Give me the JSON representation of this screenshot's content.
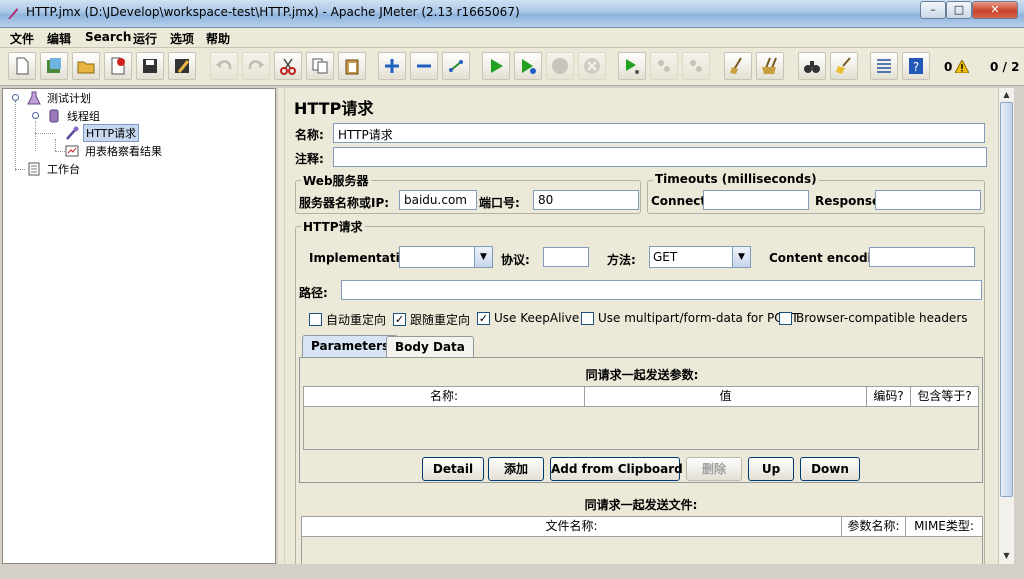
{
  "window": {
    "title": "HTTP.jmx (D:\\JDevelop\\workspace-test\\HTTP.jmx) - Apache JMeter (2.13 r1665067)",
    "controls": {
      "minimize": "–",
      "maximize": "□",
      "close": "✕"
    }
  },
  "menu": [
    "文件",
    "编辑",
    "Search",
    "运行",
    "选项",
    "帮助"
  ],
  "toolbar": {
    "buttons": [
      "new-icon",
      "templates-icon",
      "open-icon",
      "close-file-icon",
      "save-icon",
      "save-as-icon",
      "undo-icon",
      "redo-icon",
      "cut-icon",
      "copy-icon",
      "paste-icon",
      "expand-icon",
      "collapse-icon",
      "toggle-icon",
      "start-icon",
      "start-no-pause-icon",
      "stop-icon",
      "shutdown-icon",
      "remote-start-icon",
      "remote-stop-icon",
      "remote-shutdown-icon",
      "clear-icon",
      "clear-all-icon",
      "search-icon",
      "reset-search-icon",
      "function-helper-icon",
      "help-icon"
    ],
    "error_count": "0",
    "thread_count": "0 / 2"
  },
  "tree": {
    "test_plan": "测试计划",
    "thread_group": "线程组",
    "http_request": "HTTP请求",
    "result_table": "用表格察看结果",
    "workbench": "工作台"
  },
  "panel": {
    "heading": "HTTP请求",
    "name_label": "名称:",
    "name_value": "HTTP请求",
    "comment_label": "注释:",
    "comment_value": "",
    "web_server": {
      "title": "Web服务器",
      "server_label": "服务器名称或IP:",
      "server_value": "baidu.com",
      "port_label": "端口号:",
      "port_value": "80"
    },
    "timeouts": {
      "title": "Timeouts (milliseconds)",
      "connect_label": "Connect:",
      "connect_value": "",
      "response_label": "Response:",
      "response_value": ""
    },
    "http_request": {
      "title": "HTTP请求",
      "implementation_label": "Implementation:",
      "implementation_value": "",
      "protocol_label": "协议:",
      "protocol_value": "",
      "method_label": "方法:",
      "method_value": "GET",
      "encoding_label": "Content encoding:",
      "encoding_value": "",
      "path_label": "路径:",
      "path_value": ""
    },
    "options": [
      {
        "label": "自动重定向",
        "checked": false
      },
      {
        "label": "跟随重定向",
        "checked": true
      },
      {
        "label": "Use KeepAlive",
        "checked": true
      },
      {
        "label": "Use multipart/form-data for POST",
        "checked": false
      },
      {
        "label": "Browser-compatible headers",
        "checked": false
      }
    ],
    "tabs": [
      "Parameters",
      "Body Data"
    ],
    "params_caption": "同请求一起发送参数:",
    "params_columns": [
      "名称:",
      "值",
      "编码?",
      "包含等于?"
    ],
    "param_buttons": [
      "Detail",
      "添加",
      "Add from Clipboard",
      "删除",
      "Up",
      "Down"
    ],
    "files_caption": "同请求一起发送文件:",
    "files_columns": [
      "文件名称:",
      "参数名称:",
      "MIME类型:"
    ]
  }
}
